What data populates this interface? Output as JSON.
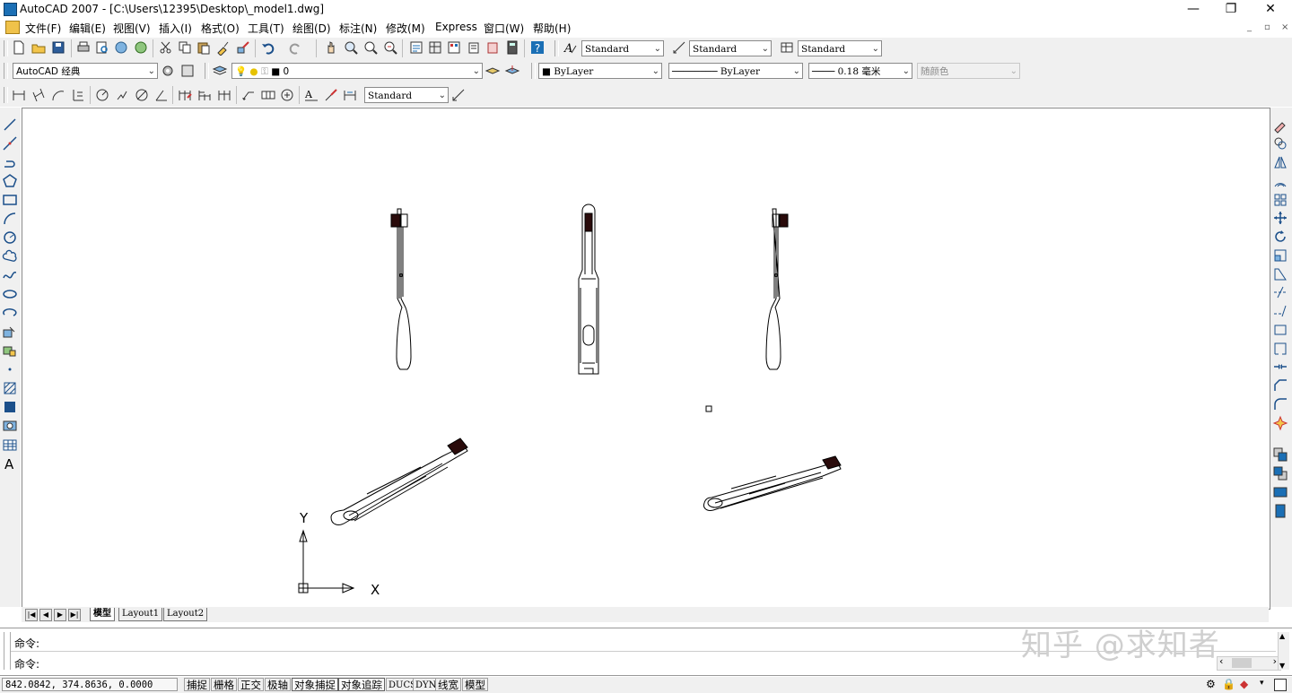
{
  "window": {
    "title": "AutoCAD 2007 - [C:\\Users\\12395\\Desktop\\_model1.dwg]",
    "minimize_glyph": "—",
    "restore_glyph": "❐",
    "close_glyph": "✕",
    "doc_minimize_glyph": "_",
    "doc_restore_glyph": "▫",
    "doc_close_glyph": "×"
  },
  "menu": [
    "文件(F)",
    "编辑(E)",
    "视图(V)",
    "插入(I)",
    "格式(O)",
    "工具(T)",
    "绘图(D)",
    "标注(N)",
    "修改(M)",
    "Express",
    "窗口(W)",
    "帮助(H)"
  ],
  "styles": {
    "text_style": "Standard",
    "dim_style": "Standard",
    "table_style": "Standard",
    "dim_toolbar_style": "Standard"
  },
  "workspace": "AutoCAD 经典",
  "layer": "0",
  "properties": {
    "color": "ByLayer",
    "linetype": "ByLayer",
    "lineweight": "0.18 毫米",
    "plotstyle": "随颜色"
  },
  "tabs": [
    "模型",
    "Layout1",
    "Layout2"
  ],
  "command": {
    "line1": "命令:",
    "line2": "命令:"
  },
  "status": {
    "coordinates": "842.0842, 374.8636, 0.0000",
    "toggles": [
      {
        "label": "捕捉",
        "on": false
      },
      {
        "label": "栅格",
        "on": false
      },
      {
        "label": "正交",
        "on": false
      },
      {
        "label": "极轴",
        "on": false
      },
      {
        "label": "对象捕捉",
        "on": true
      },
      {
        "label": "对象追踪",
        "on": true
      },
      {
        "label": "DUCS",
        "on": false
      },
      {
        "label": "DYN",
        "on": false
      },
      {
        "label": "线宽",
        "on": false
      },
      {
        "label": "模型",
        "on": false
      }
    ]
  },
  "ucs": {
    "x_label": "X",
    "y_label": "Y"
  },
  "watermark": "知乎 @求知者",
  "colors": {
    "accent": "#1b6fb5",
    "toolbar_bg": "#f0f0f0",
    "canvas_bg": "#ffffff"
  }
}
